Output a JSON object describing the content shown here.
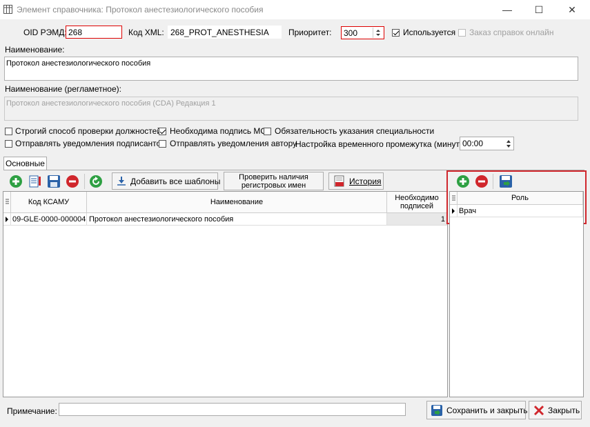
{
  "window": {
    "title": "Элемент справочника: Протокол анестезиологического пособия",
    "minimize": "—",
    "maximize": "☐",
    "close": "✕"
  },
  "top_fields": {
    "oid_label": "OID РЭМД:",
    "oid_value": "268",
    "xml_label": "Код XML:",
    "xml_value": "268_PROT_ANESTHESIA",
    "priority_label": "Приоритет:",
    "priority_value": "300",
    "used_label": "Используется",
    "used_checked": true,
    "online_label": "Заказ справок онлайн",
    "online_checked": false
  },
  "name": {
    "label": "Наименование:",
    "value": "Протокол анестезиологического пособия"
  },
  "reg_name": {
    "label": "Наименование (регламетное):",
    "value": "Протокол анестезиологического пособия (CDA) Редакция 1"
  },
  "options": {
    "strict_check": "Строгий способ проверки должностей",
    "mo_sign": "Необходима подпись МО",
    "specialty_required": "Обязательность указания специальности",
    "notify_signers": "Отправлять уведомления подписантов",
    "notify_author": "Отправлять уведомления автору",
    "interval_label": "Настройка временного промежутка (минуты):",
    "interval_value": "00:00"
  },
  "tabs": [
    "Основные"
  ],
  "toolbar": {
    "add_all_templates": "Добавить все шаблоны",
    "check_names_line1": "Проверить наличия",
    "check_names_line2": "регистровых имен",
    "history": "История"
  },
  "main_grid": {
    "columns": [
      "Код КСАМУ",
      "Наименование",
      "Необходимо подписей"
    ],
    "rows": [
      {
        "code": "09-GLE-0000-000004",
        "name": "Протокол анестезиологического пособия",
        "signatures": "1"
      }
    ]
  },
  "role_grid": {
    "columns": [
      "Роль"
    ],
    "rows": [
      "Врач"
    ]
  },
  "footer": {
    "note_label": "Примечание:",
    "note_value": "",
    "save_close": "Сохранить и закрыть",
    "close": "Закрыть"
  },
  "colors": {
    "highlight_red": "#d0262c",
    "add_green": "#2ea043",
    "delete_red": "#d0262c"
  }
}
